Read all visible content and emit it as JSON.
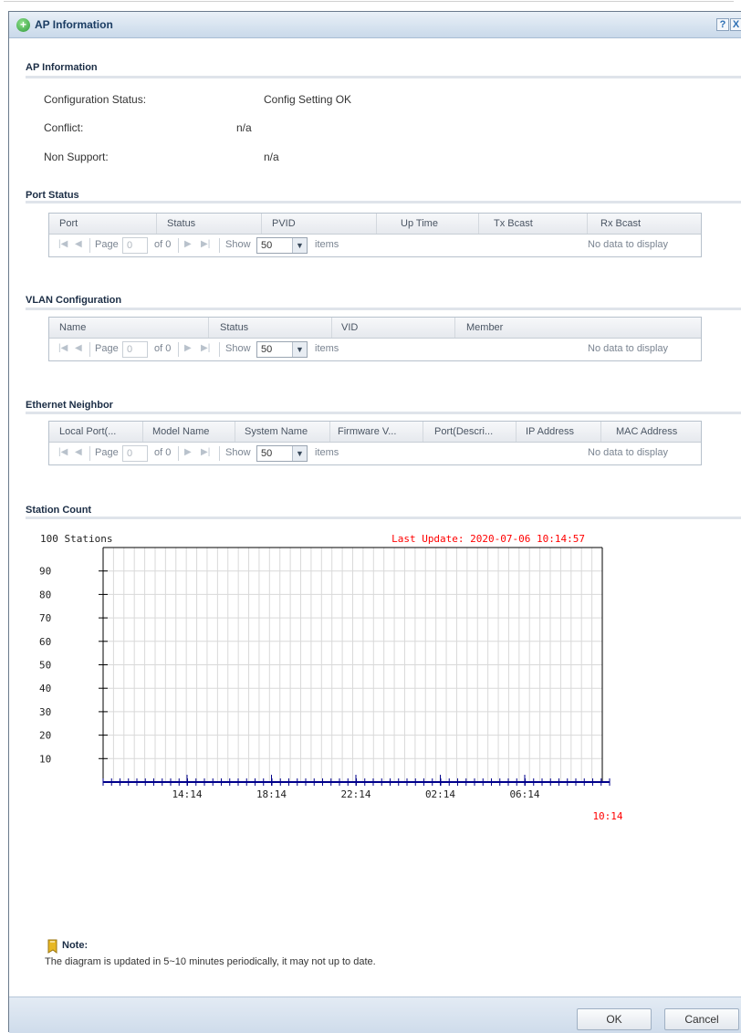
{
  "dialog": {
    "title": "AP Information",
    "help_icon": "?",
    "close_icon": "X"
  },
  "ap_info": {
    "section_title": "AP Information",
    "config_status_label": "Configuration Status:",
    "config_status_value": "Config Setting OK",
    "conflict_label": "Conflict:",
    "conflict_value": "n/a",
    "non_support_label": "Non Support:",
    "non_support_value": "n/a"
  },
  "port_status": {
    "section_title": "Port Status",
    "columns": [
      "Port",
      "Status",
      "PVID",
      "Up Time",
      "Tx Bcast",
      "Rx Bcast"
    ]
  },
  "vlan": {
    "section_title": "VLAN Configuration",
    "columns": [
      "Name",
      "Status",
      "VID",
      "Member"
    ]
  },
  "ethernet": {
    "section_title": "Ethernet Neighbor",
    "columns": [
      "Local Port(...",
      "Model Name",
      "System Name",
      "Firmware V...",
      "Port(Descri...",
      "IP Address",
      "MAC Address"
    ]
  },
  "pager": {
    "page_label": "Page",
    "page_value": "0",
    "of_label": "of 0",
    "show_label": "Show",
    "show_value": "50",
    "items_label": "items",
    "empty_text": "No data to display"
  },
  "station_count": {
    "section_title": "Station Count"
  },
  "chart_data": {
    "type": "line",
    "title": "",
    "ylabel": "100 Stations",
    "last_update": "Last Update: 2020-07-06 10:14:57",
    "y_ticks": [
      90,
      80,
      70,
      60,
      50,
      40,
      30,
      20,
      10
    ],
    "ylim": [
      0,
      100
    ],
    "x_ticks": [
      "14:14",
      "18:14",
      "22:14",
      "02:14",
      "06:14"
    ],
    "x_end_label": "10:14",
    "grid": true,
    "series": [],
    "colors": {
      "accent": "#ff0000",
      "axis": "#00008b",
      "grid": "#d9d9d9"
    }
  },
  "note": {
    "title": "Note:",
    "text": "The diagram is updated in 5~10 minutes periodically, it may not up to date."
  },
  "footer": {
    "ok_label": "OK",
    "cancel_label": "Cancel"
  }
}
